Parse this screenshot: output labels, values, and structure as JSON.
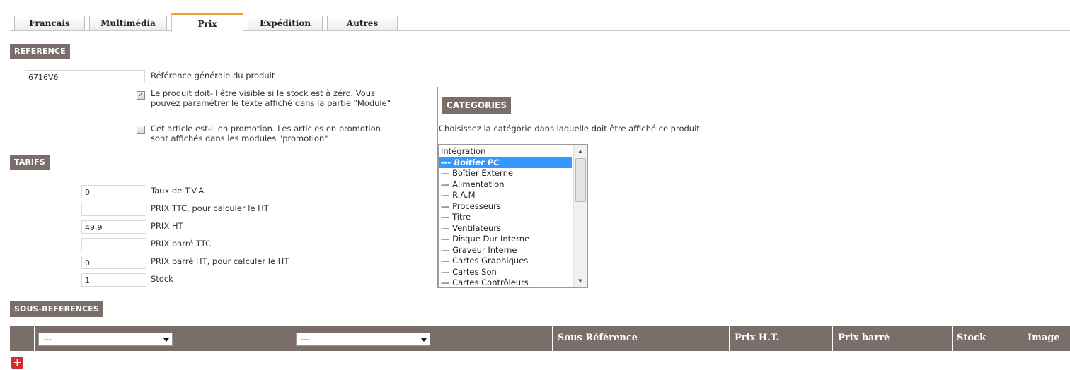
{
  "tabs": [
    {
      "label": "Francais"
    },
    {
      "label": "Multimédia"
    },
    {
      "label": "Prix"
    },
    {
      "label": "Expédition"
    },
    {
      "label": "Autres"
    }
  ],
  "active_tab": "Prix",
  "reference": {
    "header": "REFERENCE",
    "value": "6716V6",
    "label": "Référence générale du produit",
    "visible_zero_stock": {
      "checked": true,
      "line1": "Le produit doit-il être visible si le stock est à zéro. Vous",
      "line2": "pouvez paramétrer le texte affiché dans la partie \"Module\""
    },
    "promotion": {
      "checked": false,
      "line1": "Cet article est-il en promotion. Les articles en promotion",
      "line2": "sont affichés dans les modules \"promotion\""
    }
  },
  "tarifs": {
    "header": "TARIFS",
    "rows": [
      {
        "value": "0",
        "label": "Taux de T.V.A."
      },
      {
        "value": "",
        "label": "PRIX TTC, pour calculer le HT"
      },
      {
        "value": "49,9",
        "label": "PRIX HT"
      },
      {
        "value": "",
        "label": "PRIX barré TTC"
      },
      {
        "value": "0",
        "label": "PRIX barré HT, pour calculer le HT"
      },
      {
        "value": "1",
        "label": "Stock"
      }
    ]
  },
  "categories": {
    "header": "CATEGORIES",
    "instruction": "Choisissez la catégorie dans laquelle doit être affiché ce produit",
    "selected": "--- Boitier PC",
    "options": [
      "Intégration",
      "--- Boitier PC",
      "--- Boîtier Externe",
      "--- Alimentation",
      "--- R.A.M",
      "--- Processeurs",
      "--- Titre",
      "--- Ventilateurs",
      "--- Disque Dur Interne",
      "--- Graveur Interne",
      "--- Cartes Graphiques",
      "--- Cartes Son",
      "--- Cartes Contrôleurs"
    ]
  },
  "sous_references": {
    "header": "SOUS-REFERENCES",
    "select1": "---",
    "select2": "---",
    "columns": [
      "Sous Référence",
      "Prix H.T.",
      "Prix barré",
      "Stock",
      "Image"
    ]
  },
  "icons": {
    "add": "plus-icon",
    "checkbox_mark": "✓"
  },
  "colors": {
    "section_header": "#7a6e6a",
    "active_tab_accent": "#f0a030",
    "selection": "#3399ff",
    "add_button": "#d8292f"
  }
}
